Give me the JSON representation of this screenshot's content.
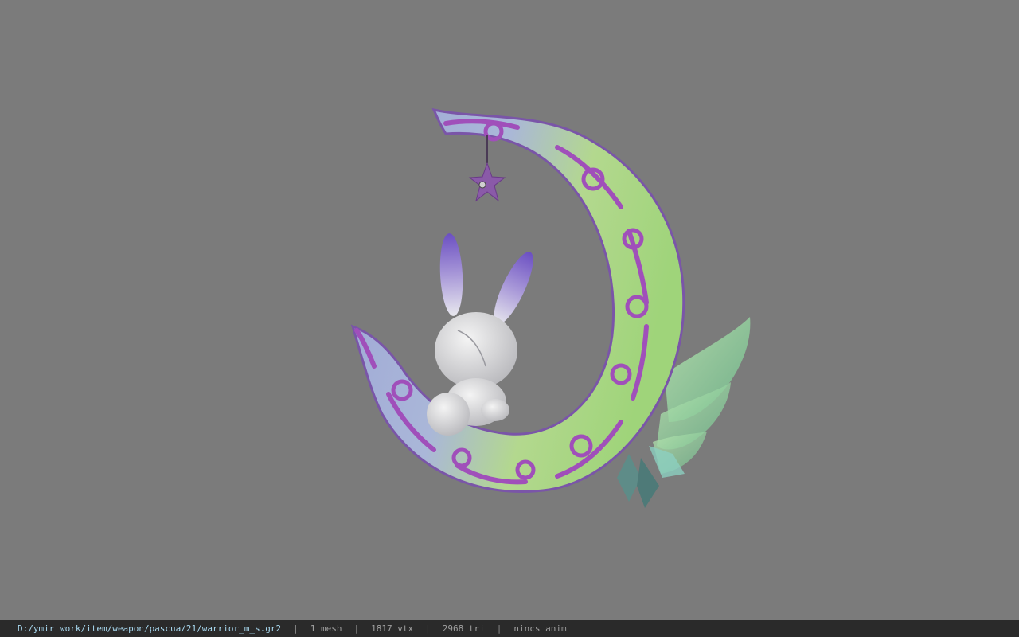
{
  "viewer": {
    "background_color": "#7b7b7b",
    "model_name": "crescent-moon-bunny-weapon"
  },
  "status_bar": {
    "file_path": "D:/ymir work/item/weapon/pascua/21/warrior_m_s.gr2",
    "separator": "|",
    "mesh_count": "1 mesh",
    "vertex_count": "1817 vtx",
    "triangle_count": "2968 tri",
    "anim_status": "nincs anim",
    "colors": {
      "path": "#a8d8ef",
      "background": "#2a2a2a",
      "text": "#a0a0a0"
    }
  }
}
